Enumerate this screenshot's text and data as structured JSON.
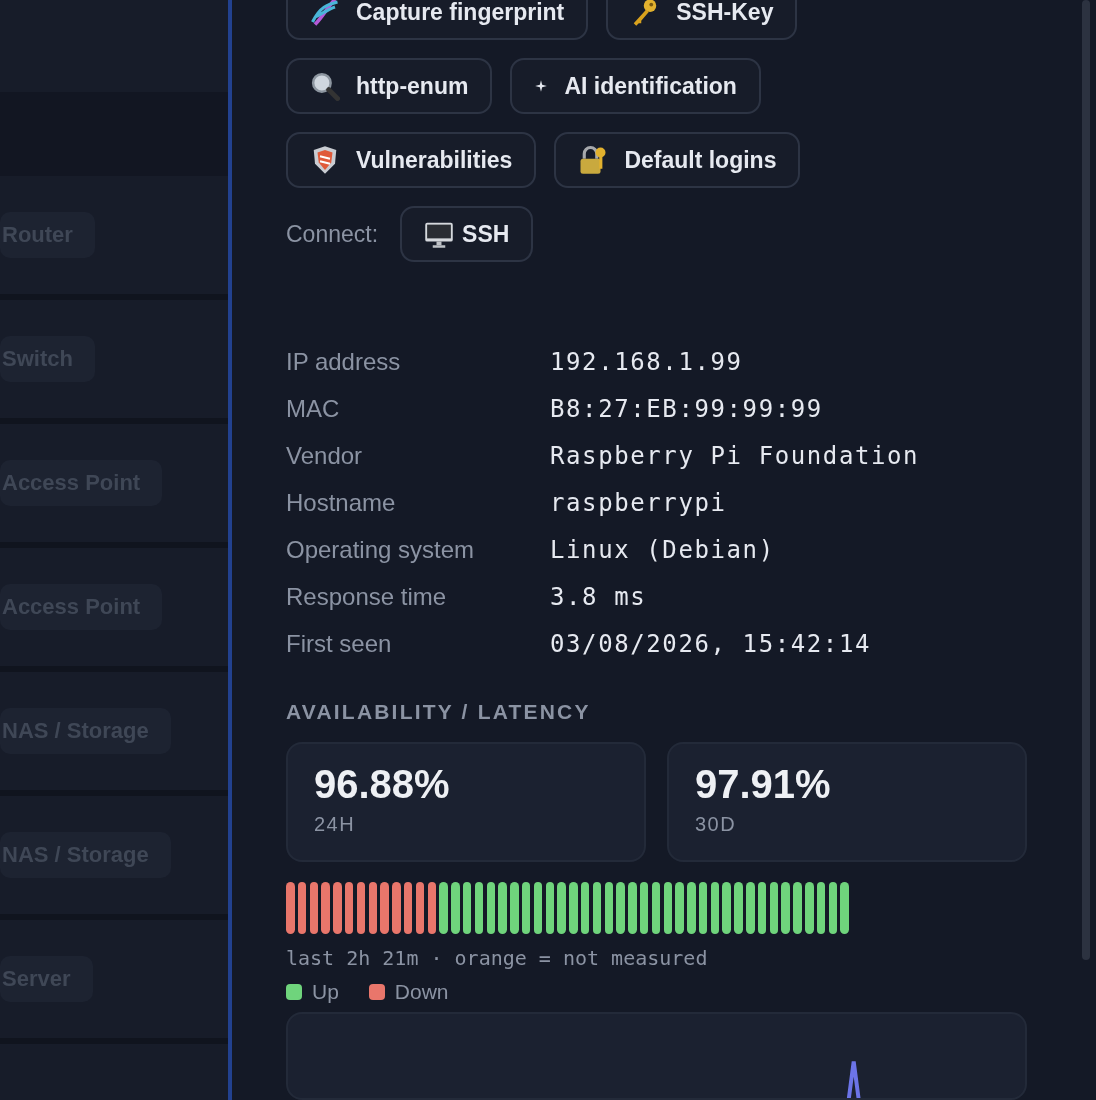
{
  "device_list": [
    {
      "tag": "Router"
    },
    {
      "tag": "Switch"
    },
    {
      "tag": "Access Point"
    },
    {
      "tag": "Access Point"
    },
    {
      "tag": "NAS / Storage"
    },
    {
      "tag": "NAS / Storage"
    },
    {
      "tag": "Server"
    }
  ],
  "actions": [
    {
      "kind": "dna",
      "label": "Capture fingerprint"
    },
    {
      "kind": "key",
      "label": "SSH-Key"
    },
    {
      "kind": "search",
      "label": "http-enum"
    },
    {
      "kind": "sparkle",
      "label": "AI identification"
    },
    {
      "kind": "shield",
      "label": "Vulnerabilities"
    },
    {
      "kind": "lock",
      "label": "Default logins"
    }
  ],
  "connect": {
    "label": "Connect:",
    "buttons": [
      {
        "kind": "monitor",
        "label": "SSH"
      }
    ]
  },
  "details": [
    {
      "label": "IP address",
      "value": "192.168.1.99"
    },
    {
      "label": "MAC",
      "value": "B8:27:EB:99:99:99"
    },
    {
      "label": "Vendor",
      "value": "Raspberry Pi Foundation"
    },
    {
      "label": "Hostname",
      "value": "raspberrypi"
    },
    {
      "label": "Operating system",
      "value": "Linux (Debian)"
    },
    {
      "label": "Response time",
      "value": "3.8 ms"
    },
    {
      "label": "First seen",
      "value": "03/08/2026, 15:42:14"
    }
  ],
  "availability": {
    "title": "AVAILABILITY / LATENCY",
    "stats": [
      {
        "value": "96.88%",
        "period": "24H"
      },
      {
        "value": "97.91%",
        "period": "30D"
      }
    ],
    "history": [
      {
        "up": false
      },
      {
        "up": false
      },
      {
        "up": false
      },
      {
        "up": false
      },
      {
        "up": false
      },
      {
        "up": false
      },
      {
        "up": false
      },
      {
        "up": false
      },
      {
        "up": false
      },
      {
        "up": false
      },
      {
        "up": false
      },
      {
        "up": false
      },
      {
        "up": false
      },
      {
        "up": true
      },
      {
        "up": true
      },
      {
        "up": true
      },
      {
        "up": true
      },
      {
        "up": true
      },
      {
        "up": true
      },
      {
        "up": true
      },
      {
        "up": true
      },
      {
        "up": true
      },
      {
        "up": true
      },
      {
        "up": true
      },
      {
        "up": true
      },
      {
        "up": true
      },
      {
        "up": true
      },
      {
        "up": true
      },
      {
        "up": true
      },
      {
        "up": true
      },
      {
        "up": true
      },
      {
        "up": true
      },
      {
        "up": true
      },
      {
        "up": true
      },
      {
        "up": true
      },
      {
        "up": true
      },
      {
        "up": true
      },
      {
        "up": true
      },
      {
        "up": true
      },
      {
        "up": true
      },
      {
        "up": true
      },
      {
        "up": true
      },
      {
        "up": true
      },
      {
        "up": true
      },
      {
        "up": true
      },
      {
        "up": true
      },
      {
        "up": true
      },
      {
        "up": true
      }
    ],
    "caption": "last 2h 21m · orange = not measured",
    "legend": [
      {
        "label": "Up",
        "color": "#6fd47c"
      },
      {
        "label": "Down",
        "color": "#e9766b"
      }
    ]
  }
}
